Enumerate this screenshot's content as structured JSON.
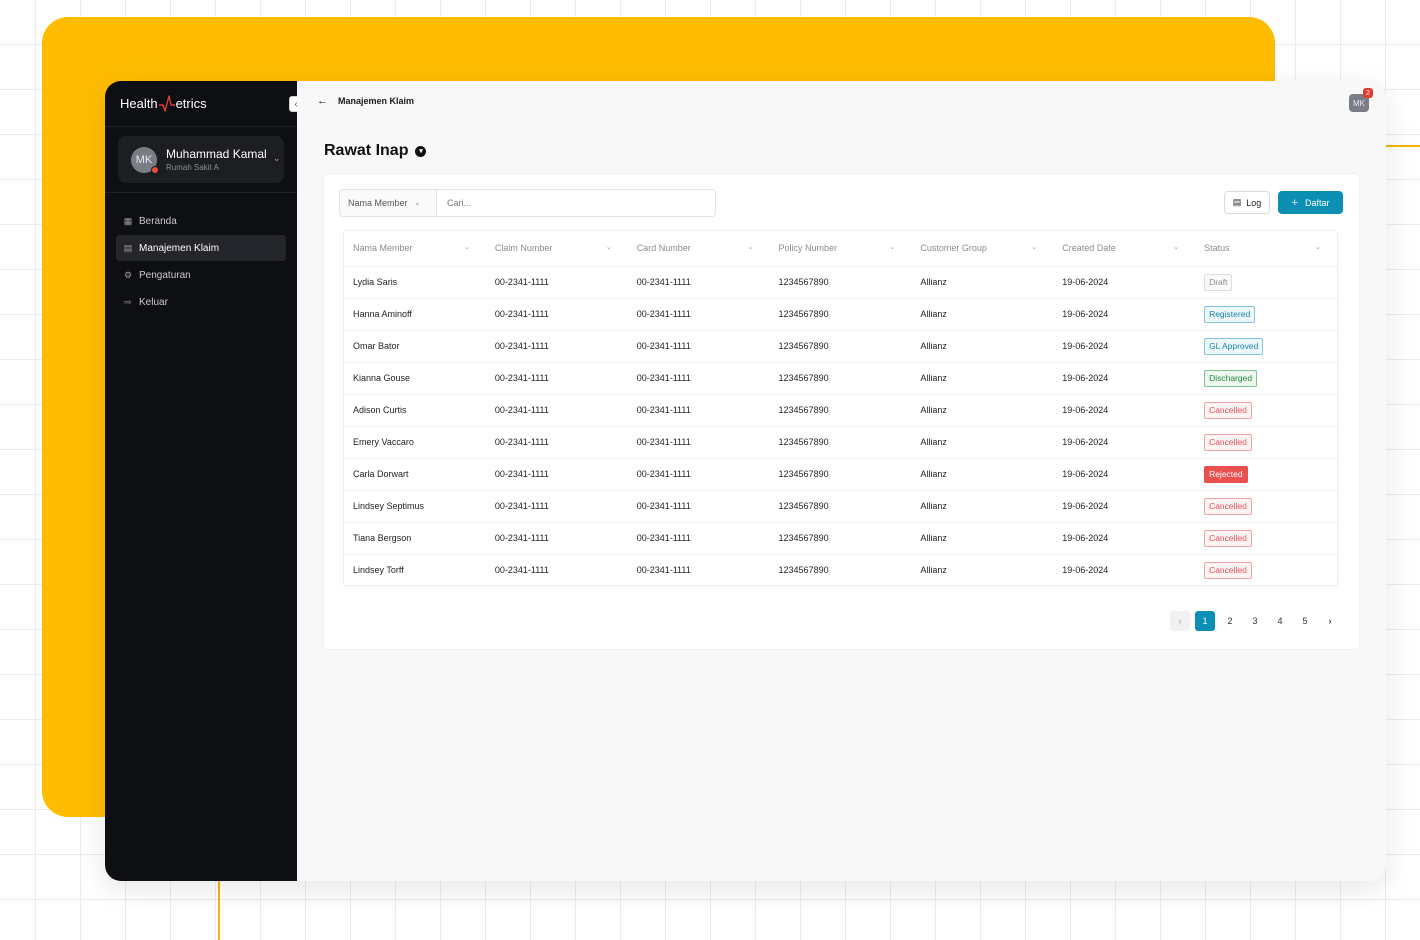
{
  "app": {
    "logo_prefix": "Health",
    "logo_suffix": "etrics"
  },
  "user": {
    "initials": "MK",
    "name": "Muhammad Kamal",
    "org": "Rumah Sakit A"
  },
  "sidebar": {
    "items": [
      {
        "label": "Beranda",
        "icon": "grid-icon",
        "active": false
      },
      {
        "label": "Manajemen Klaim",
        "icon": "document-icon",
        "active": true
      },
      {
        "label": "Pengaturan",
        "icon": "gear-icon",
        "active": false
      },
      {
        "label": "Keluar",
        "icon": "logout-icon",
        "active": false
      }
    ]
  },
  "topbar": {
    "breadcrumb": "Manajemen Klaim",
    "avatar_initials": "MK",
    "notification_count": "2"
  },
  "page": {
    "title": "Rawat Inap"
  },
  "filter": {
    "field_label": "Nama Member",
    "search_placeholder": "Cari..."
  },
  "actions": {
    "log_label": "Log",
    "daftar_label": "Daftar"
  },
  "table": {
    "columns": [
      "Nama Member",
      "Claim Number",
      "Card Number",
      "Policy Number",
      "Customer Group",
      "Created Date",
      "Status"
    ],
    "rows": [
      {
        "name": "Lydia Saris",
        "claim": "00-2341-1111",
        "card": "00-2341-1111",
        "policy": "1234567890",
        "group": "Allianz",
        "date": "19-06-2024",
        "status": "Draft",
        "status_type": "draft"
      },
      {
        "name": "Hanna Aminoff",
        "claim": "00-2341-1111",
        "card": "00-2341-1111",
        "policy": "1234567890",
        "group": "Allianz",
        "date": "19-06-2024",
        "status": "Registered",
        "status_type": "registered"
      },
      {
        "name": "Omar Bator",
        "claim": "00-2341-1111",
        "card": "00-2341-1111",
        "policy": "1234567890",
        "group": "Allianz",
        "date": "19-06-2024",
        "status": "GL Approved",
        "status_type": "glapproved"
      },
      {
        "name": "Kianna Gouse",
        "claim": "00-2341-1111",
        "card": "00-2341-1111",
        "policy": "1234567890",
        "group": "Allianz",
        "date": "19-06-2024",
        "status": "Discharged",
        "status_type": "discharged"
      },
      {
        "name": "Adison Curtis",
        "claim": "00-2341-1111",
        "card": "00-2341-1111",
        "policy": "1234567890",
        "group": "Allianz",
        "date": "19-06-2024",
        "status": "Cancelled",
        "status_type": "cancelled"
      },
      {
        "name": "Emery Vaccaro",
        "claim": "00-2341-1111",
        "card": "00-2341-1111",
        "policy": "1234567890",
        "group": "Allianz",
        "date": "19-06-2024",
        "status": "Cancelled",
        "status_type": "cancelled"
      },
      {
        "name": "Carla Dorwart",
        "claim": "00-2341-1111",
        "card": "00-2341-1111",
        "policy": "1234567890",
        "group": "Allianz",
        "date": "19-06-2024",
        "status": "Rejected",
        "status_type": "rejected"
      },
      {
        "name": "Lindsey Septimus",
        "claim": "00-2341-1111",
        "card": "00-2341-1111",
        "policy": "1234567890",
        "group": "Allianz",
        "date": "19-06-2024",
        "status": "Cancelled",
        "status_type": "cancelled"
      },
      {
        "name": "Tiana Bergson",
        "claim": "00-2341-1111",
        "card": "00-2341-1111",
        "policy": "1234567890",
        "group": "Allianz",
        "date": "19-06-2024",
        "status": "Cancelled",
        "status_type": "cancelled"
      },
      {
        "name": "Lindsey Torff",
        "claim": "00-2341-1111",
        "card": "00-2341-1111",
        "policy": "1234567890",
        "group": "Allianz",
        "date": "19-06-2024",
        "status": "Cancelled",
        "status_type": "cancelled"
      }
    ]
  },
  "pagination": {
    "pages": [
      "1",
      "2",
      "3",
      "4",
      "5"
    ],
    "current": "1"
  },
  "colors": {
    "accent": "#0C8FB4",
    "sidebar_bg": "#0E0F12",
    "brand_yellow": "#FFBC00",
    "logo_pulse": "#E23B2F"
  }
}
